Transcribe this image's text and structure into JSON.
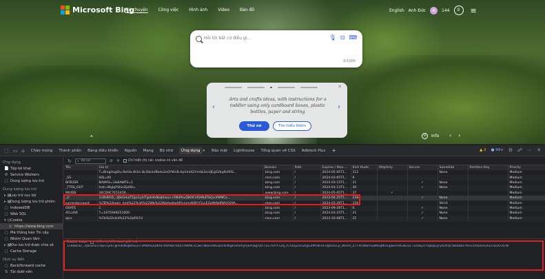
{
  "bing": {
    "logo_text": "Microsoft Bing",
    "nav": [
      "Trò chuyện",
      "Công việc",
      "Hình ảnh",
      "Video",
      "Bản đồ"
    ],
    "nav_selected_index": 0,
    "lang": "English",
    "user": "Anh Đức",
    "points": "144",
    "search_placeholder": "Hỏi tôi bất cứ điều gì...",
    "char_count": "0/1000",
    "card": {
      "text": "Arts and crafts ideas, with instructions for a toddler using only cardboard boxes, plastic bottles, paper and string",
      "primary": "Thử nó",
      "secondary": "Tìm hiểu thêm"
    },
    "info_label": "Info"
  },
  "devtools": {
    "tabs": [
      "Chào mừng",
      "Thành phần",
      "Bảng điều khiển",
      "Nguồn",
      "Mạng",
      "Bộ nhớ",
      "Ứng dụng",
      "Bảo mật",
      "Lighthouse",
      "Tổng quan về CSS",
      "Adblock Plus"
    ],
    "selected_tab_index": 6,
    "warnings": "2",
    "issues": "99+",
    "sidebar": [
      {
        "type": "header",
        "label": "Ứng dụng"
      },
      {
        "type": "item",
        "label": "Tệp kê khai",
        "icon": "📄",
        "level": 1
      },
      {
        "type": "item",
        "label": "Service Workers",
        "icon": "⚙",
        "level": 1
      },
      {
        "type": "item",
        "label": "Dung lượng lưu trữ",
        "icon": "▢",
        "level": 1
      },
      {
        "type": "header",
        "label": "Dung lượng lưu trữ"
      },
      {
        "type": "item",
        "label": "Lưu trữ cục bộ",
        "icon": "▸ ▦",
        "level": 1
      },
      {
        "type": "item",
        "label": "Dung lượng lưu trữ phiên",
        "icon": "▸ ▦",
        "level": 1
      },
      {
        "type": "item",
        "label": "IndexedDB",
        "icon": "▢",
        "level": 1
      },
      {
        "type": "item",
        "label": "Web SQL",
        "icon": "▢",
        "level": 1
      },
      {
        "type": "item",
        "label": "Cookie",
        "icon": "▾ ◎",
        "level": 1
      },
      {
        "type": "item",
        "label": "https://www.bing.com",
        "icon": "◎",
        "level": 2,
        "selected": true
      },
      {
        "type": "item",
        "label": "Mã thông báo Tin cậy",
        "icon": "▢",
        "level": 1
      },
      {
        "type": "item",
        "label": "Nhóm Quan tâm",
        "icon": "▢",
        "level": 1
      },
      {
        "type": "item",
        "label": "Kho lưu trữ được chia sẻ",
        "icon": "▸ ▦",
        "level": 1
      },
      {
        "type": "item",
        "label": "Cache Storage",
        "icon": "▢",
        "level": 1
      },
      {
        "type": "header",
        "label": "Dịch vụ Nền"
      },
      {
        "type": "item",
        "label": "Back/forward cache",
        "icon": "▢",
        "level": 1
      },
      {
        "type": "item",
        "label": "Tải dưới nền",
        "icon": "⇅",
        "level": 1
      }
    ],
    "toolbar": {
      "filter_placeholder": "Bộ lọc",
      "only_issues": "Chỉ hiển thị các cookie có vấn đề"
    },
    "columns": [
      "Tên",
      "Giá trị",
      "Domain",
      "Path",
      "Expires / Max-...",
      "Kích thước",
      "HttpOnly",
      "Secure",
      "SameSite",
      "Partition Key",
      "Priority"
    ],
    "rows": [
      [
        "",
        "T=BingImgStu.RetVa.W3ni.BcObiaVBkdo2eQYWnB.ApVm0GiYmSk3nnIJEgS3bq9cRfGi...",
        ".bing.com",
        "/",
        "2024-05-05T1...",
        "112",
        "",
        "",
        "None",
        "",
        "Medium"
      ],
      [
        "_SS",
        "SID=00",
        ".msn.com",
        "/",
        "2024-03-05T1...",
        "9",
        "",
        "",
        "",
        "",
        "Medium"
      ],
      [
        "BFBUSR",
        "BAWAS=1&BAWFS=1",
        ".bing.com",
        "/",
        "2024-03-15T1...",
        "21",
        "",
        "✓",
        "None",
        "",
        "Medium"
      ],
      [
        "_TTSS_OUT",
        "hist=WyJqYShinZpIlI0=",
        ".bing.com",
        "/",
        "2024-03-13T1...",
        "30",
        "",
        "✓",
        "None",
        "",
        "Medium"
      ],
      [
        "MUIDB",
        "26CD9C7E51456...",
        ".www.bing.com",
        "/",
        "2024-05-05T1...",
        "37",
        "✓",
        "",
        "",
        "",
        "Medium"
      ],
      [
        "_U",
        "1cBkBOD_-2JlkGHuITDps1yhlTgHnKdKqbhouv-r3MdPsuQlKAFsf0ANdTbQcnfWMCs...",
        ".bing.com",
        "/",
        "2023-04-25T1...",
        "238",
        "",
        "✓",
        "None",
        "",
        "Medium"
      ],
      [
        "currentaccount",
        "%7B%22login_hint%22%3A%22Wb%22WbApI4wXJPvnmnW8Yrf1LcEZqlWNdfWUO29A...",
        ".msn.com",
        "/",
        "2024-03-29T1...",
        "150",
        "",
        "",
        "Strict",
        "",
        "Medium"
      ],
      [
        "OSATE",
        "1",
        ".bing.com",
        "/",
        "2023-09-28T1...",
        "6",
        "",
        "✓",
        "None",
        "",
        "Medium"
      ],
      [
        "ACLUSR",
        "T=1675948251000",
        ".bing.com",
        "/",
        "2024-03-15T1...",
        "21",
        "",
        "✓",
        "None",
        "",
        "Medium"
      ],
      [
        "ajce",
        "%7b%22ckid%22%3a0%7d",
        ".msn.com",
        "/",
        "2023-10-08T1...",
        "25",
        "",
        "✓",
        "None",
        "",
        "Medium"
      ]
    ],
    "selected_row_index": 5,
    "cookie_value": {
      "label": "Cookie Value",
      "decode_label": "Hiển thị URL được giải mã",
      "value": "1cBkBOD_-2JlkGHuITDps1yhlTgHnKdKqbhouv-r3MdPsuQlKAFsf0ANdTbQcnfWMCsCwk7NeEVWEDDrIlrWgFoV0rhyfyerHagYjhr7Zu70YrFs2q_m70SjZocSXgGdMY8F0FUgOOvCp_WOIH_Z7r-RnWbmxoMeqtKrEqjBem9GwU2C7Zi0bjZFYqBqGyrykOYQCfB0b8D7RFD1mwUnDucsruOO1S-W"
    },
    "colors": {
      "accent": "#8ab4f8",
      "highlight": "#e02020",
      "bing_blue": "#2a5bd7"
    }
  }
}
